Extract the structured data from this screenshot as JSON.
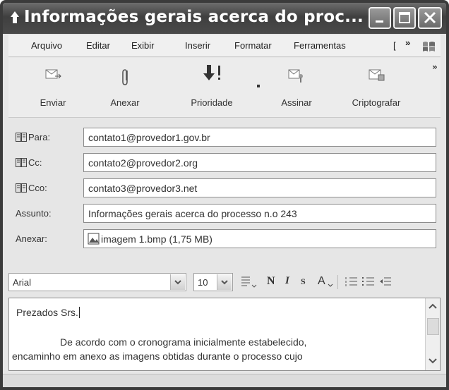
{
  "window": {
    "title": "Informações gerais acerca do proc...",
    "controls": [
      "minimize-icon",
      "maximize-icon",
      "close-icon"
    ]
  },
  "menubar": {
    "items": [
      {
        "label": "Arquivo"
      },
      {
        "label": "Editar"
      },
      {
        "label": "Exibir"
      },
      {
        "label": "Inserir"
      },
      {
        "label": "Formatar"
      },
      {
        "label": "Ferramentas"
      },
      {
        "label": "["
      }
    ],
    "overflow": "»"
  },
  "toolbar": {
    "buttons": [
      {
        "label": "Enviar",
        "icon": "send-icon"
      },
      {
        "label": "Anexar",
        "icon": "paperclip-icon"
      },
      {
        "label": "Prioridade",
        "icon": "priority-icon"
      },
      {
        "label": "Assinar",
        "icon": "sign-icon"
      },
      {
        "label": "Criptografar",
        "icon": "encrypt-icon"
      }
    ],
    "overflow": "»"
  },
  "fields": {
    "to": {
      "label": "Para:",
      "value": "contato1@provedor1.gov.br"
    },
    "cc": {
      "label": "Cc:",
      "value": "contato2@provedor2.org"
    },
    "bcc": {
      "label": "Cco:",
      "value": "contato3@provedor3.net"
    },
    "subject": {
      "label": "Assunto:",
      "value": "Informações gerais acerca do processo n.o 243"
    },
    "attach": {
      "label": "Anexar:",
      "value": "imagem 1.bmp (1,75 MB)"
    }
  },
  "format": {
    "font": "Arial",
    "size": "10",
    "bold": "N",
    "italic": "I",
    "underline": "S",
    "color": "A"
  },
  "body": {
    "line1": "Prezados Srs.",
    "line2": "De acordo com o cronograma inicialmente estabelecido,",
    "line3": "encaminho em anexo as imagens obtidas durante o processo cujo"
  }
}
